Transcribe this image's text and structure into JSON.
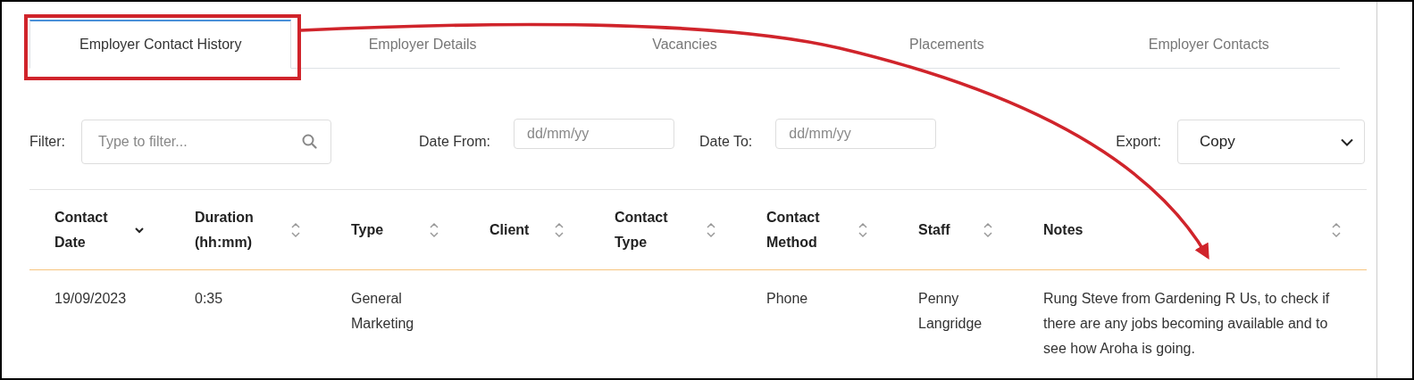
{
  "tabs": [
    {
      "label": "Employer Contact History",
      "selected": true
    },
    {
      "label": "Employer Details",
      "selected": false
    },
    {
      "label": "Vacancies",
      "selected": false
    },
    {
      "label": "Placements",
      "selected": false
    },
    {
      "label": "Employer Contacts",
      "selected": false
    }
  ],
  "filter": {
    "label": "Filter:",
    "placeholder": "Type to filter..."
  },
  "date_from": {
    "label": "Date From:",
    "placeholder": "dd/mm/yy"
  },
  "date_to": {
    "label": "Date To:",
    "placeholder": "dd/mm/yy"
  },
  "export": {
    "label": "Export:",
    "value": "Copy"
  },
  "table": {
    "columns": [
      {
        "label": "Contact Date",
        "sorted": true
      },
      {
        "label": "Duration (hh:mm)",
        "sorted": false
      },
      {
        "label": "Type",
        "sorted": false
      },
      {
        "label": "Client",
        "sorted": false
      },
      {
        "label": "Contact Type",
        "sorted": false
      },
      {
        "label": "Contact Method",
        "sorted": false
      },
      {
        "label": "Staff",
        "sorted": false
      },
      {
        "label": "Notes",
        "sorted": false
      }
    ],
    "rows": [
      {
        "cells": [
          "19/09/2023",
          "0:35",
          "General Marketing",
          "",
          "",
          "Phone",
          "Penny Langridge",
          "Rung Steve from Gardening R Us, to check if there are any jobs becoming available and to see how Aroha is going."
        ]
      }
    ]
  }
}
